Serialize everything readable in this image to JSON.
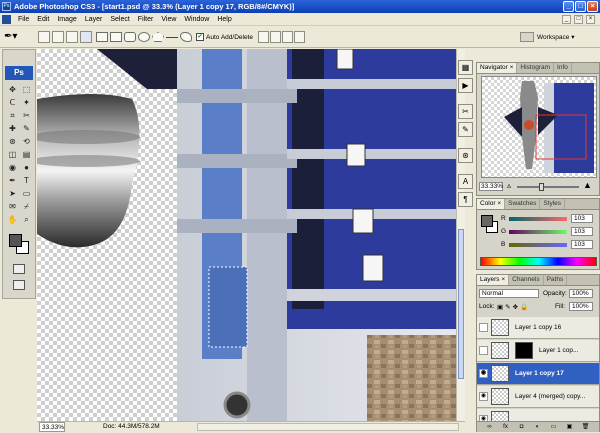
{
  "window": {
    "title": "Adobe Photoshop CS3 - [start1.psd @ 33.3% (Layer 1 copy 17, RGB/8#/CMYK)]",
    "app_badge": "Ps",
    "controls": [
      "_",
      "□",
      "×"
    ]
  },
  "menu": {
    "items": [
      "File",
      "Edit",
      "Image",
      "Layer",
      "Select",
      "Filter",
      "View",
      "Window",
      "Help"
    ],
    "doc_controls": [
      "_",
      "□",
      "×"
    ]
  },
  "options_bar": {
    "auto_add_label": "Auto Add/Delete",
    "auto_add_checked": true,
    "workspace_label": "Workspace ▾"
  },
  "tools": {
    "logo": "Ps",
    "icons": [
      "move-icon",
      "marquee-icon",
      "lasso-icon",
      "magic-wand-icon",
      "crop-icon",
      "slice-icon",
      "healing-icon",
      "brush-icon",
      "stamp-icon",
      "history-brush-icon",
      "eraser-icon",
      "gradient-icon",
      "blur-icon",
      "dodge-icon",
      "pen-icon",
      "type-icon",
      "path-select-icon",
      "shape-icon",
      "notes-icon",
      "eyedropper-icon",
      "hand-icon",
      "zoom-icon"
    ],
    "glyphs": [
      "✥",
      "⬚",
      "ᑕ",
      "✦",
      "⌗",
      "✂",
      "✚",
      "✎",
      "⊛",
      "⟲",
      "◫",
      "▤",
      "◉",
      "●",
      "✒",
      "T",
      "➤",
      "▭",
      "✉",
      "⌿",
      "✋",
      "⌕"
    ]
  },
  "status": {
    "zoom": "33.33%",
    "doc": "Doc: 44.3M/578.2M"
  },
  "navigator": {
    "tabs": [
      "Navigator ×",
      "Histogram",
      "Info"
    ],
    "zoom": "33.33%"
  },
  "color": {
    "tabs": [
      "Color ×",
      "Swatches",
      "Styles"
    ],
    "rows": [
      {
        "label": "R",
        "value": "103"
      },
      {
        "label": "G",
        "value": "103"
      },
      {
        "label": "B",
        "value": "103"
      }
    ]
  },
  "layers": {
    "tabs": [
      "Layers ×",
      "Channels",
      "Paths"
    ],
    "blend_mode": "Normal",
    "opacity_label": "Opacity:",
    "opacity": "100%",
    "lock_label": "Lock:",
    "fill_label": "Fill:",
    "fill": "100%",
    "rows": [
      {
        "name": "Layer 1 copy 16",
        "selected": false,
        "visible": false,
        "has_mask": false
      },
      {
        "name": "Layer 1 cop...",
        "selected": false,
        "visible": false,
        "has_mask": true
      },
      {
        "name": "Layer 1 copy 17",
        "selected": true,
        "visible": true,
        "has_mask": false
      },
      {
        "name": "Layer 4 (merged) copy...",
        "selected": false,
        "visible": true,
        "has_mask": false
      },
      {
        "name": "",
        "selected": false,
        "visible": true,
        "has_mask": false
      }
    ],
    "footer_icons": [
      "link-icon",
      "fx-icon",
      "mask-icon",
      "adjustment-icon",
      "group-icon",
      "new-layer-icon",
      "trash-icon"
    ],
    "footer_glyphs": [
      "∞",
      "fx",
      "◘",
      "◐",
      "▭",
      "▣",
      "🗑"
    ]
  },
  "colors": {
    "titlebar": "#0d3fb3",
    "selection": "#3160c3",
    "building_blue": "#2c3b9c"
  }
}
